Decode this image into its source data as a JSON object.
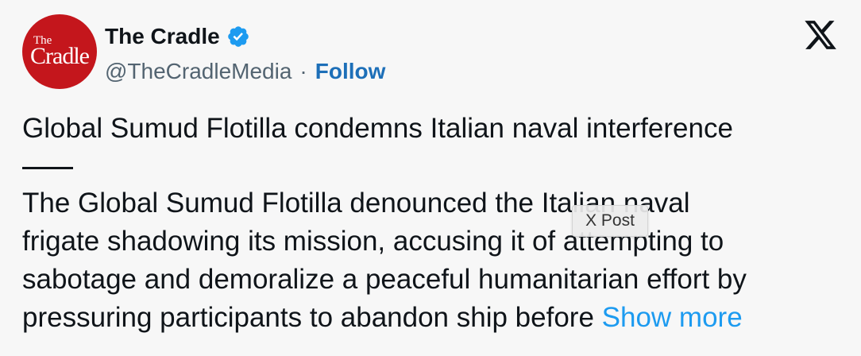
{
  "header": {
    "display_name": "The Cradle",
    "handle": "@TheCradleMedia",
    "separator": "·",
    "follow_label": "Follow",
    "avatar_text_top": "The",
    "avatar_text_bottom": "Cradle",
    "verified_icon": "verified-badge-icon",
    "brand_icon": "x-logo-icon"
  },
  "post": {
    "headline": "Global Sumud Flotilla condemns Italian naval interference",
    "body_lines": [
      "The Global Sumud Flotilla denounced the Italian naval",
      "frigate shadowing its mission, accusing it of attempting to",
      "sabotage and demoralize a peaceful humanitarian effort by",
      "pressuring participants to abandon ship before "
    ],
    "show_more_label": "Show more"
  },
  "tooltip": {
    "text": "X Post"
  },
  "colors": {
    "avatar_bg": "#c4161c",
    "verified": "#1d9bf0",
    "follow": "#1d6fb8",
    "link": "#1d9bf0",
    "text": "#0f1419",
    "muted": "#536471",
    "background": "#f7f7f7"
  }
}
